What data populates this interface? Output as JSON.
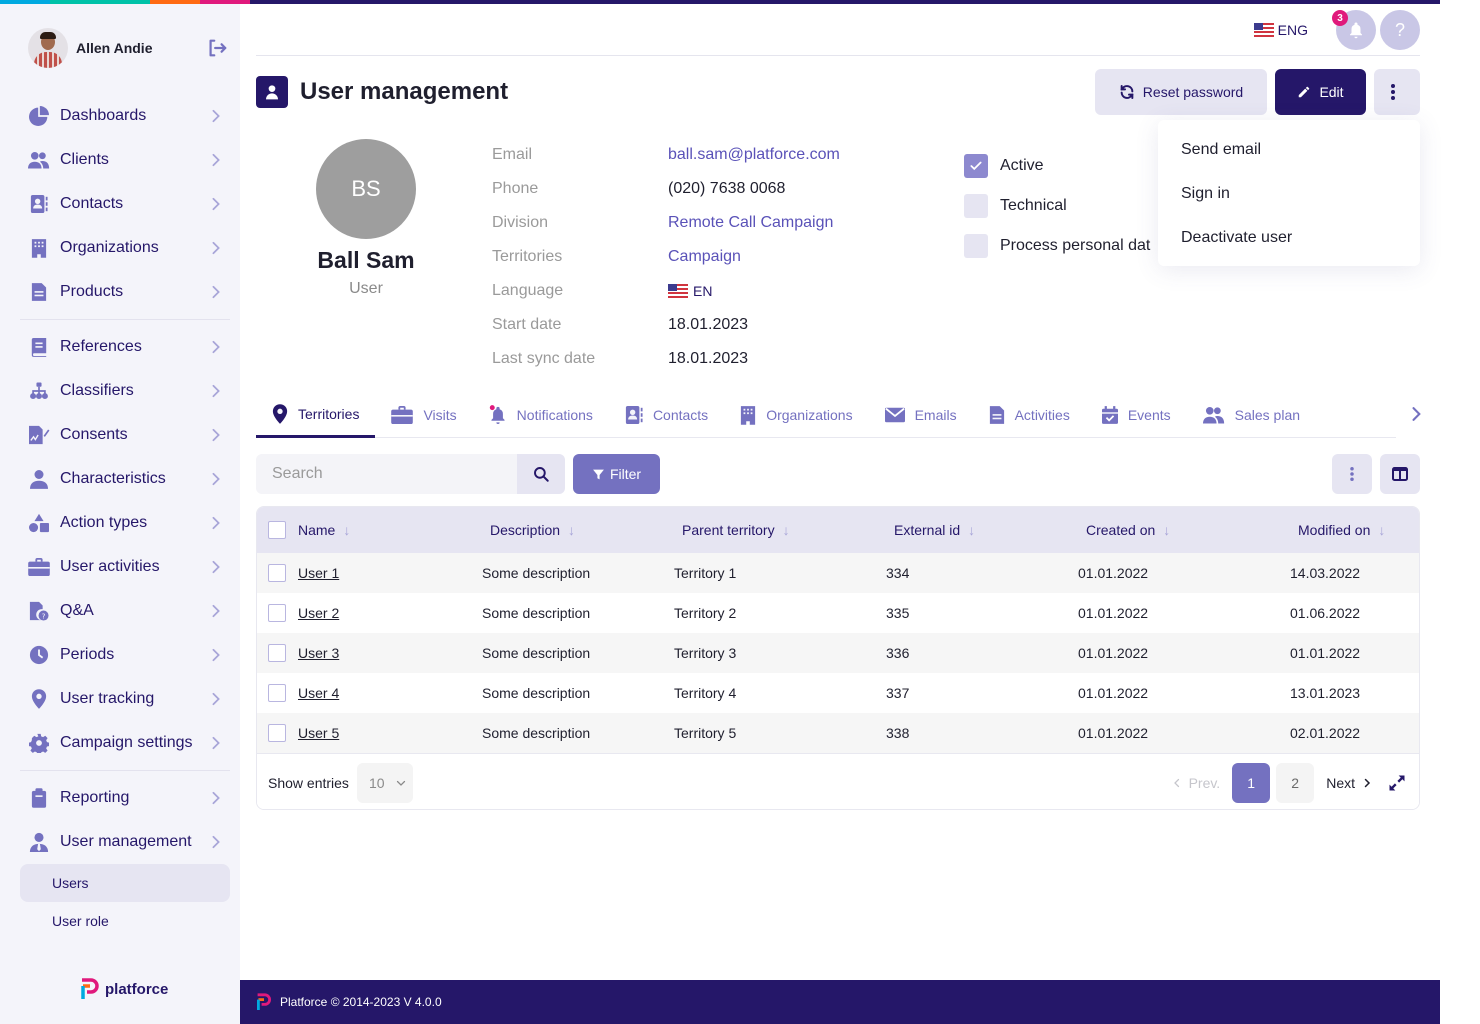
{
  "colors": {
    "primary": "#251769",
    "accent": "#7471c0",
    "accent_light": "#e6e5f2",
    "badge": "#e0197c",
    "stripe": [
      "#00a9e0",
      "#00c2a8",
      "#ff6a13",
      "#e0197c",
      "#251769"
    ]
  },
  "sidebar": {
    "user_name": "Allen Andie",
    "groups": [
      [
        {
          "label": "Dashboards",
          "icon": "pie-chart-icon"
        },
        {
          "label": "Clients",
          "icon": "users-icon"
        },
        {
          "label": "Contacts",
          "icon": "address-book-icon"
        },
        {
          "label": "Organizations",
          "icon": "building-icon"
        },
        {
          "label": "Products",
          "icon": "document-icon"
        }
      ],
      [
        {
          "label": "References",
          "icon": "book-icon"
        },
        {
          "label": "Classifiers",
          "icon": "sitemap-icon"
        },
        {
          "label": "Consents",
          "icon": "signature-icon"
        },
        {
          "label": "Characteristics",
          "icon": "user-icon"
        },
        {
          "label": "Action types",
          "icon": "shapes-icon"
        },
        {
          "label": "User activities",
          "icon": "briefcase-icon"
        },
        {
          "label": "Q&A",
          "icon": "file-question-icon"
        },
        {
          "label": "Periods",
          "icon": "clock-icon"
        },
        {
          "label": "User tracking",
          "icon": "map-pin-icon"
        },
        {
          "label": "Campaign settings",
          "icon": "gear-icon"
        }
      ],
      [
        {
          "label": "Reporting",
          "icon": "clipboard-icon"
        },
        {
          "label": "User management",
          "icon": "user-tie-icon"
        }
      ]
    ],
    "sub_items": [
      {
        "label": "Users",
        "active": true
      },
      {
        "label": "User role",
        "active": false
      }
    ],
    "brand": "platforce"
  },
  "topbar": {
    "language": "ENG",
    "notifications_count": "3",
    "help": "?"
  },
  "header": {
    "title": "User management",
    "reset_password": "Reset password",
    "edit": "Edit"
  },
  "dropdown": {
    "items": [
      "Send email",
      "Sign in",
      "Deactivate user"
    ]
  },
  "profile": {
    "initials": "BS",
    "name": "Ball Sam",
    "role": "User",
    "details": [
      {
        "label": "Email",
        "value": "ball.sam@platforce.com",
        "link": true
      },
      {
        "label": "Phone",
        "value": "(020) 7638 0068",
        "link": false
      },
      {
        "label": "Division",
        "value": "Remote Call Campaign",
        "link": true
      },
      {
        "label": "Territories",
        "value": "Campaign",
        "link": true
      },
      {
        "label": "Language",
        "value": "EN",
        "link": false
      },
      {
        "label": "Start date",
        "value": "18.01.2023",
        "link": false
      },
      {
        "label": "Last sync date",
        "value": "18.01.2023",
        "link": false
      }
    ],
    "flags": [
      {
        "label": "Active",
        "checked": true
      },
      {
        "label": "Technical",
        "checked": false
      },
      {
        "label": "Process personal dat",
        "checked": false
      }
    ]
  },
  "tabs": [
    {
      "label": "Territories",
      "icon": "map-pin-icon",
      "active": true
    },
    {
      "label": "Visits",
      "icon": "briefcase-icon",
      "active": false
    },
    {
      "label": "Notifications",
      "icon": "bell-icon",
      "active": false
    },
    {
      "label": "Contacts",
      "icon": "address-book-icon",
      "active": false
    },
    {
      "label": "Organizations",
      "icon": "building-icon",
      "active": false
    },
    {
      "label": "Emails",
      "icon": "envelope-icon",
      "active": false
    },
    {
      "label": "Activities",
      "icon": "document-icon",
      "active": false
    },
    {
      "label": "Events",
      "icon": "calendar-check-icon",
      "active": false
    },
    {
      "label": "Sales plan",
      "icon": "users-icon",
      "active": false
    }
  ],
  "toolbar": {
    "search_placeholder": "Search",
    "filter": "Filter"
  },
  "table": {
    "columns": [
      "Name",
      "Description",
      "Parent territory",
      "External id",
      "Created on",
      "Modified on"
    ],
    "rows": [
      [
        "User 1",
        "Some description",
        "Territory 1",
        "334",
        "01.01.2022",
        "14.03.2022"
      ],
      [
        "User 2",
        "Some description",
        "Territory 2",
        "335",
        "01.01.2022",
        "01.06.2022"
      ],
      [
        "User 3",
        "Some description",
        "Territory 3",
        "336",
        "01.01.2022",
        "01.01.2022"
      ],
      [
        "User 4",
        "Some description",
        "Territory 4",
        "337",
        "01.01.2022",
        "13.01.2023"
      ],
      [
        "User 5",
        "Some description",
        "Territory 5",
        "338",
        "01.01.2022",
        "02.01.2022"
      ]
    ],
    "show_entries_label": "Show entries",
    "page_size": "10",
    "prev": "Prev.",
    "next": "Next",
    "pages": [
      "1",
      "2"
    ],
    "current_page": "1"
  },
  "footer": {
    "text": "Platforce © 2014-2023 V 4.0.0"
  }
}
